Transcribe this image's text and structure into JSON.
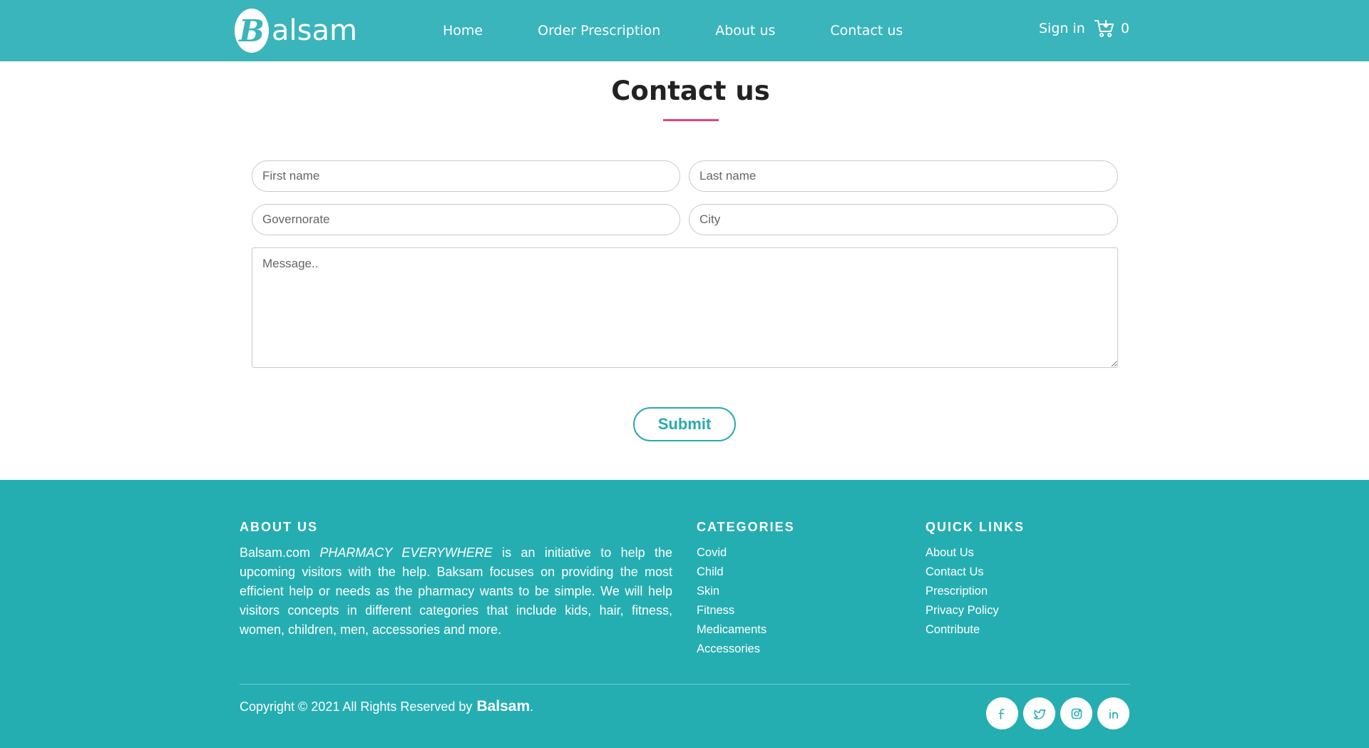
{
  "header": {
    "logo_letter": "B",
    "logo_text": "alsam",
    "nav": [
      "Home",
      "Order Prescription",
      "About us",
      "Contact us"
    ],
    "sign_in": "Sign in",
    "cart_count": "0"
  },
  "contact": {
    "title": "Contact us",
    "first_name_placeholder": "First name",
    "last_name_placeholder": "Last name",
    "governorate_placeholder": "Governorate",
    "city_placeholder": "City",
    "message_placeholder": "Message..",
    "submit_label": "Submit"
  },
  "footer": {
    "about_heading": "ABOUT US",
    "about_prefix": "Balsam.com ",
    "about_tagline": "PHARMACY EVERYWHERE",
    "about_body": " is an initiative to help the upcoming visitors with the help. Baksam focuses on providing the most efficient help or needs as the pharmacy wants to be simple. We will help visitors concepts in different categories that include kids, hair, fitness, women, children, men, accessories and more.",
    "categories_heading": "CATEGORIES",
    "categories": [
      "Covid",
      "Child",
      "Skin",
      "Fitness",
      "Medicaments",
      "Accessories"
    ],
    "quick_links_heading": "QUICK LINKS",
    "quick_links": [
      "About Us",
      "Contact Us",
      "Prescription",
      "Privacy Policy",
      "Contribute"
    ],
    "copyright": "Copyright © 2021 All Rights Reserved by",
    "brand": "Balsam",
    "brand_suffix": ".",
    "social_icons": [
      "facebook-icon",
      "twitter-icon",
      "instagram-icon",
      "linkedin-icon"
    ]
  },
  "colors": {
    "header_bg": "#3ab5bb",
    "footer_bg": "#25aeb2",
    "accent_underline": "#e2457a",
    "button_teal": "#29aaae"
  }
}
